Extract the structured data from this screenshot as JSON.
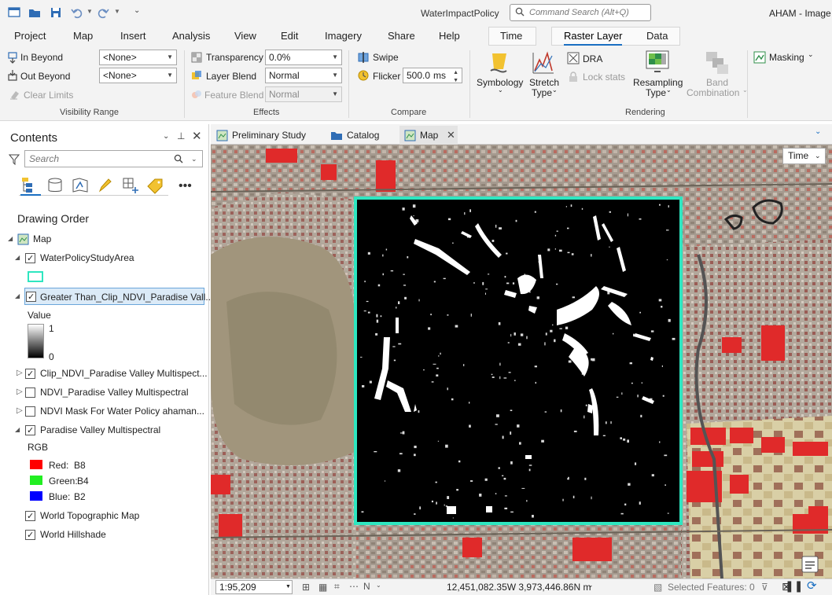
{
  "app": {
    "title": "WaterImpactPolicy",
    "user": "AHAM - Image"
  },
  "command_search": {
    "placeholder": "Command Search (Alt+Q)"
  },
  "menu": {
    "tabs": [
      "Project",
      "Map",
      "Insert",
      "Analysis",
      "View",
      "Edit",
      "Imagery",
      "Share",
      "Help"
    ],
    "contextual": [
      "Time",
      "Raster Layer",
      "Data"
    ],
    "active": "Raster Layer"
  },
  "ribbon": {
    "visibility_range": {
      "label": "Visibility Range",
      "in_beyond": "In Beyond",
      "in_beyond_value": "<None>",
      "out_beyond": "Out Beyond",
      "out_beyond_value": "<None>",
      "clear_limits": "Clear Limits"
    },
    "effects": {
      "label": "Effects",
      "transparency": "Transparency",
      "transparency_value": "0.0%",
      "layer_blend": "Layer Blend",
      "layer_blend_value": "Normal",
      "feature_blend": "Feature Blend",
      "feature_blend_value": "Normal"
    },
    "compare": {
      "label": "Compare",
      "swipe": "Swipe",
      "flicker": "Flicker",
      "flicker_value": "500.0",
      "flicker_unit": "ms"
    },
    "rendering": {
      "label": "Rendering",
      "symbology": "Symbology",
      "stretch_type_1": "Stretch",
      "stretch_type_2": "Type",
      "dra": "DRA",
      "lock_stats": "Lock stats",
      "resampling_1": "Resampling",
      "resampling_2": "Type",
      "band_combination_1": "Band",
      "band_combination_2": "Combination"
    },
    "masking": "Masking"
  },
  "contents": {
    "title": "Contents",
    "search_placeholder": "Search",
    "section": "Drawing Order",
    "layers": [
      {
        "name": "Map"
      },
      {
        "name": "WaterPolicyStudyArea"
      },
      {
        "name": "Greater Than_Clip_NDVI_Paradise Vall..."
      },
      {
        "name": "Clip_NDVI_Paradise Valley Multispect..."
      },
      {
        "name": "NDVI_Paradise Valley Multispectral"
      },
      {
        "name": "NDVI Mask For Water Policy ahaman..."
      },
      {
        "name": "Paradise Valley Multispectral"
      },
      {
        "name": "World Topographic Map"
      },
      {
        "name": "World Hillshade"
      }
    ],
    "legend_value": "Value",
    "legend_max": "1",
    "legend_min": "0",
    "rgb": "RGB",
    "bands": [
      {
        "label": "Red:",
        "band": "B8",
        "color": "#ff0000"
      },
      {
        "label": "Green:",
        "band": "B4",
        "color": "#22ee22"
      },
      {
        "label": "Blue:",
        "band": "B2",
        "color": "#0000ff"
      }
    ]
  },
  "view_tabs": [
    "Preliminary Study",
    "Catalog",
    "Map"
  ],
  "map": {
    "time_button": "Time",
    "study_area_color": "#2ee6c0"
  },
  "status": {
    "scale": "1:95,209",
    "coordinates": "12,451,082.35W 3,973,446.86N m",
    "selected_features": "Selected Features: 0"
  }
}
